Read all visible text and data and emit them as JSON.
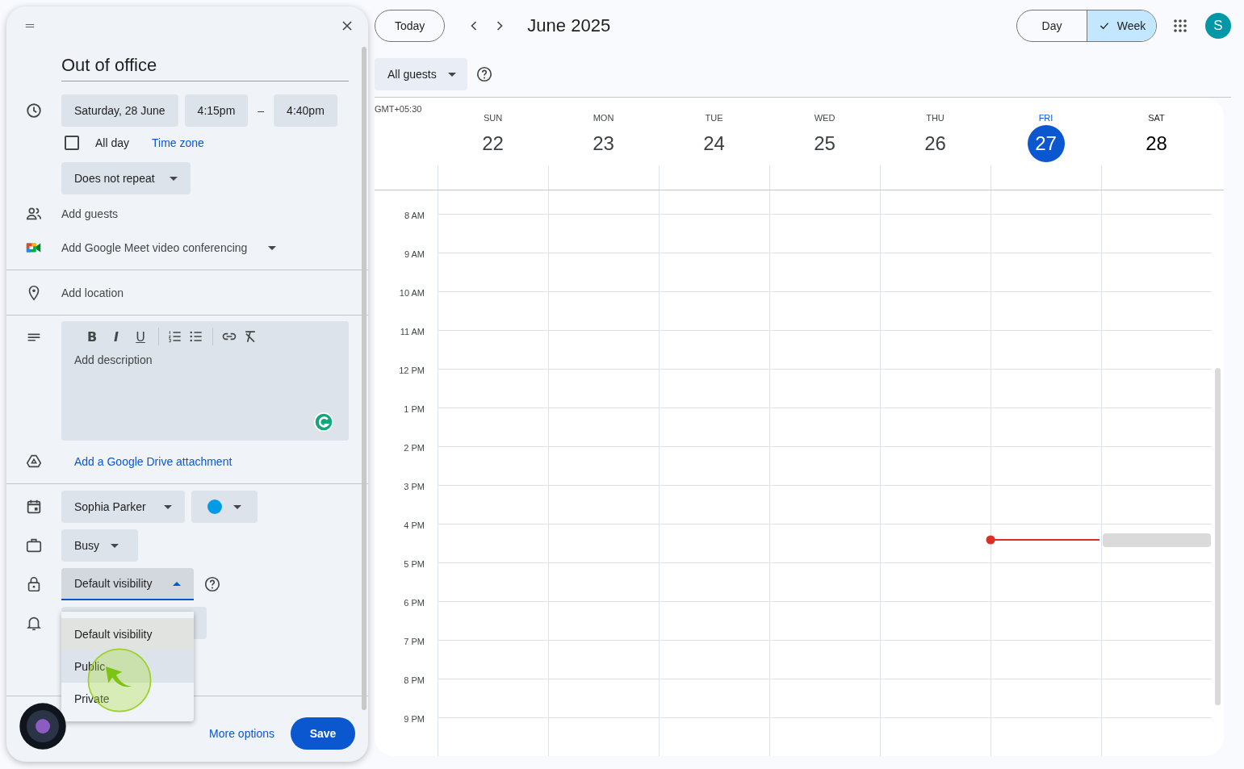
{
  "event_panel": {
    "title": "Out of office",
    "date": "Saturday, 28 June",
    "start_time": "4:15pm",
    "time_separator": "–",
    "end_time": "4:40pm",
    "all_day": {
      "label": "All day",
      "checked": false
    },
    "time_zone_link": "Time zone",
    "repeat": "Does not repeat",
    "add_guests": "Add guests",
    "meet": "Add Google Meet video conferencing",
    "location": "Add location",
    "description_toolbar": [
      {
        "kind": "bold",
        "label": "B"
      },
      {
        "kind": "italic",
        "label": "I"
      },
      {
        "kind": "underline",
        "label": "U"
      },
      {
        "kind": "numbered-list"
      },
      {
        "kind": "bulleted-list"
      },
      {
        "kind": "link"
      },
      {
        "kind": "clear-format"
      }
    ],
    "description_placeholder": "Add description",
    "drive_link": "Add a Google Drive attachment",
    "calendar": "Sophia Parker",
    "availability": "Busy",
    "visibility": {
      "value": "Default visibility",
      "expanded": true,
      "options": [
        {
          "label": "Default visibility",
          "selected": true,
          "highlighted": false
        },
        {
          "label": "Public",
          "selected": false,
          "highlighted": true
        },
        {
          "label": "Private",
          "selected": false,
          "highlighted": false
        }
      ]
    },
    "more_options": "More options",
    "save": "Save"
  },
  "toolbar": {
    "today": "Today",
    "month": "June 2025",
    "views": [
      {
        "label": "Day",
        "selected": false
      },
      {
        "label": "Week",
        "selected": true
      }
    ],
    "avatar": "S",
    "guest_filter": "All guests"
  },
  "week": {
    "timezone": "GMT+05:30",
    "days": [
      {
        "weekday": "SUN",
        "date": "22",
        "today": false,
        "draft_event": false
      },
      {
        "weekday": "MON",
        "date": "23",
        "today": false,
        "draft_event": false
      },
      {
        "weekday": "TUE",
        "date": "24",
        "today": false,
        "draft_event": false
      },
      {
        "weekday": "WED",
        "date": "25",
        "today": false,
        "draft_event": false
      },
      {
        "weekday": "THU",
        "date": "26",
        "today": false,
        "draft_event": false
      },
      {
        "weekday": "FRI",
        "date": "27",
        "today": true,
        "draft_event": false
      },
      {
        "weekday": "SAT",
        "date": "28",
        "today": false,
        "draft_event": true
      }
    ],
    "hours": [
      {
        "label": "8 AM",
        "current": false
      },
      {
        "label": "9 AM",
        "current": false
      },
      {
        "label": "10 AM",
        "current": false
      },
      {
        "label": "11 AM",
        "current": false
      },
      {
        "label": "12 PM",
        "current": false
      },
      {
        "label": "1 PM",
        "current": false
      },
      {
        "label": "2 PM",
        "current": false
      },
      {
        "label": "3 PM",
        "current": false
      },
      {
        "label": "4 PM",
        "current": true
      },
      {
        "label": "5 PM",
        "current": false
      },
      {
        "label": "6 PM",
        "current": false
      },
      {
        "label": "7 PM",
        "current": false
      },
      {
        "label": "8 PM",
        "current": false
      },
      {
        "label": "9 PM",
        "current": false
      }
    ]
  }
}
